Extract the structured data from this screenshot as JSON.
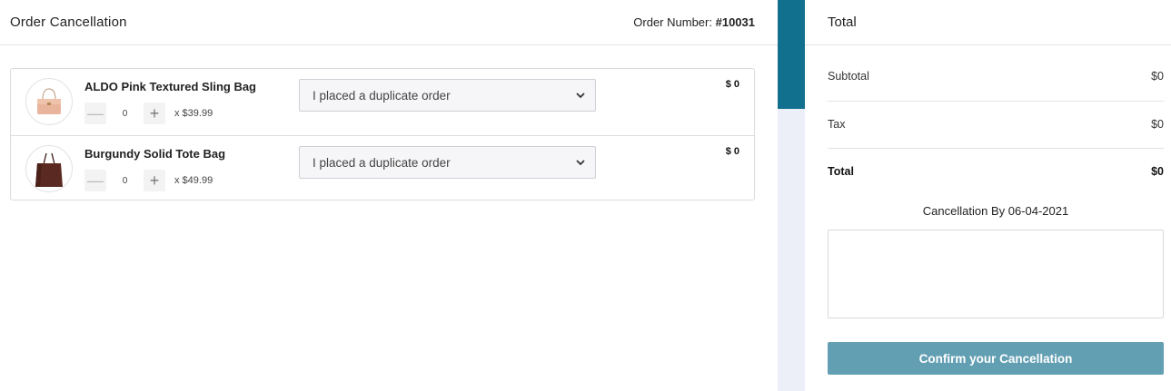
{
  "header": {
    "title": "Order Cancellation",
    "order_number_label": "Order Number:",
    "order_number": "#10031"
  },
  "items": [
    {
      "name": "ALDO Pink Textured Sling Bag",
      "quantity": "0",
      "unit_price": "x $39.99",
      "reason": "I placed a duplicate order",
      "line_total": "$ 0",
      "image": "pink-sling-bag"
    },
    {
      "name": "Burgundy Solid Tote Bag",
      "quantity": "0",
      "unit_price": "x $49.99",
      "reason": "I placed a duplicate order",
      "line_total": "$ 0",
      "image": "burgundy-tote-bag"
    }
  ],
  "summary": {
    "title": "Total",
    "subtotal_label": "Subtotal",
    "subtotal_value": "$0",
    "tax_label": "Tax",
    "tax_value": "$0",
    "total_label": "Total",
    "total_value": "$0",
    "cancellation_by": "Cancellation By 06-04-2021",
    "notes_value": "",
    "confirm_label": "Confirm your Cancellation"
  },
  "icons": {
    "minus": "minus-icon",
    "plus": "plus-icon",
    "dropdown": "chevron-down-icon"
  },
  "colors": {
    "accent": "#12708f",
    "button": "#639fb3",
    "strip": "#eceff7"
  }
}
